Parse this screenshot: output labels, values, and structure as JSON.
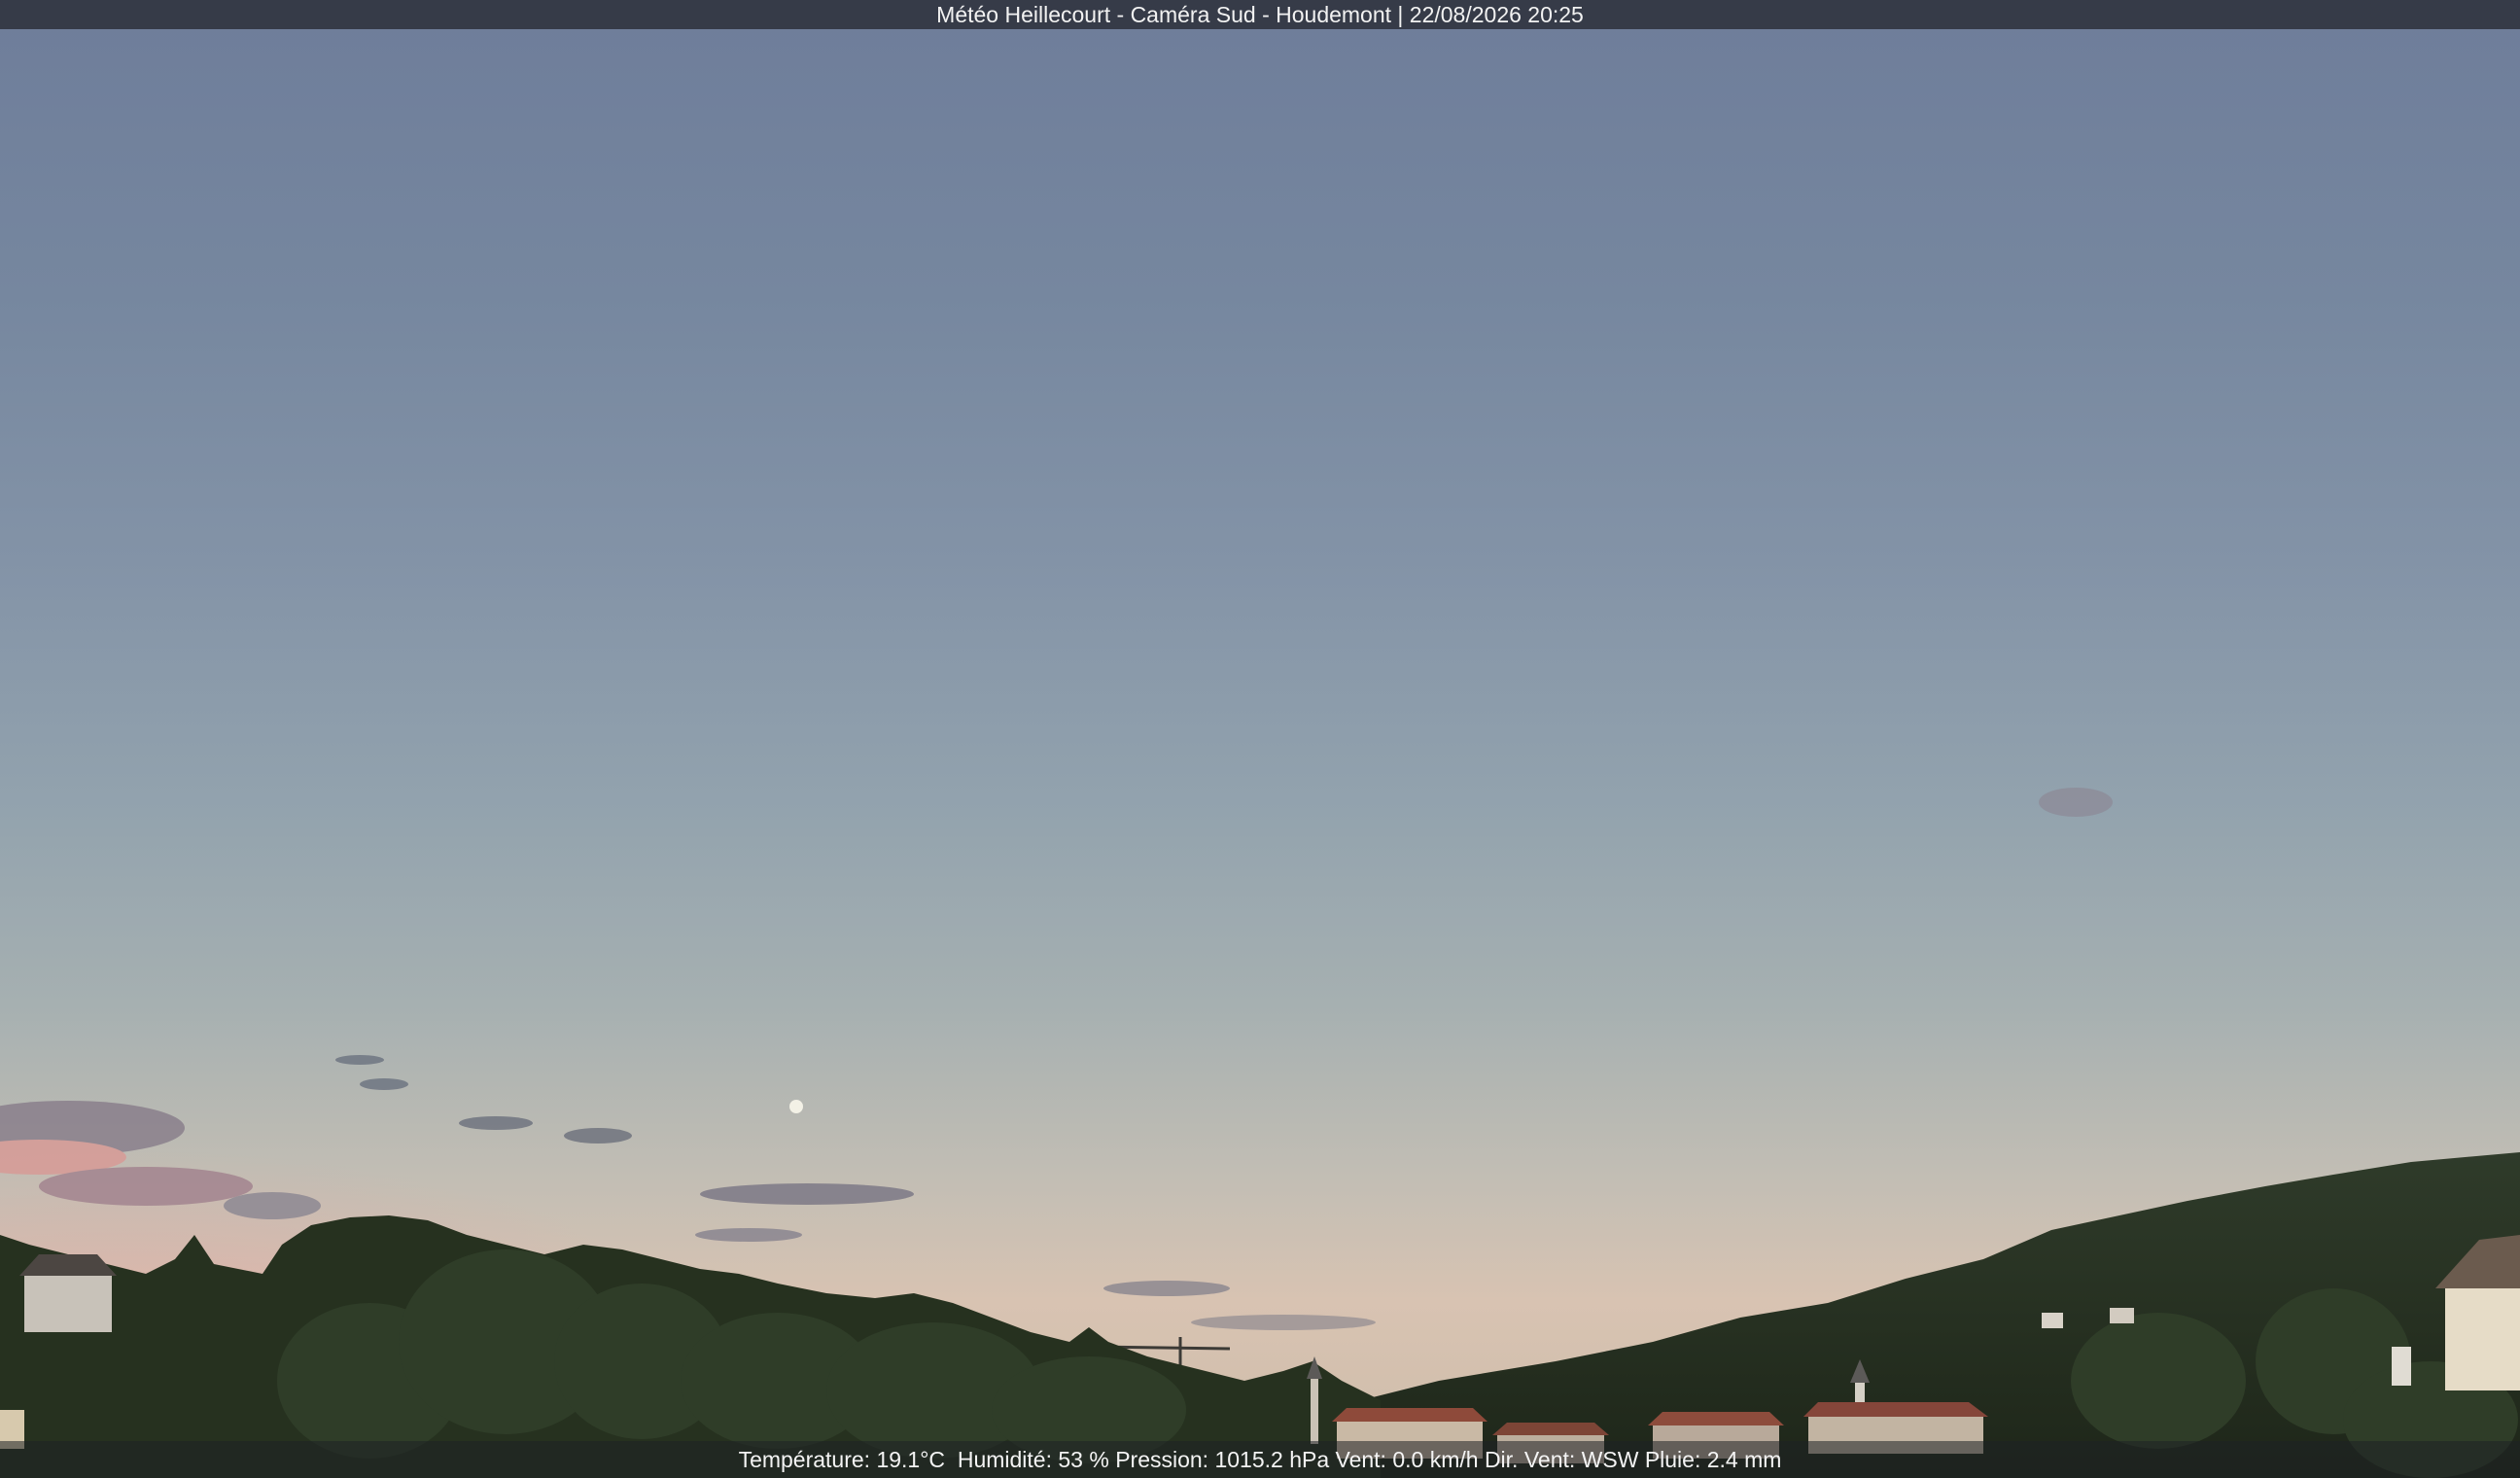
{
  "header": {
    "title": "Météo Heillecourt - Caméra Sud - Houdemont | 22/08/2026 20:25"
  },
  "weather": {
    "temperature": "Température: 19.1°C",
    "humidity": "Humidité: 53 %",
    "pressure": "Pression: 1015.2 hPa",
    "wind": "Vent: 0.0 km/h",
    "wind_direction": "Dir. Vent: WSW",
    "rain": "Pluie: 2.4 mm"
  },
  "scene": {
    "subject": "evening sky over wooded hills and village",
    "icons": [
      "moon-icon"
    ]
  }
}
